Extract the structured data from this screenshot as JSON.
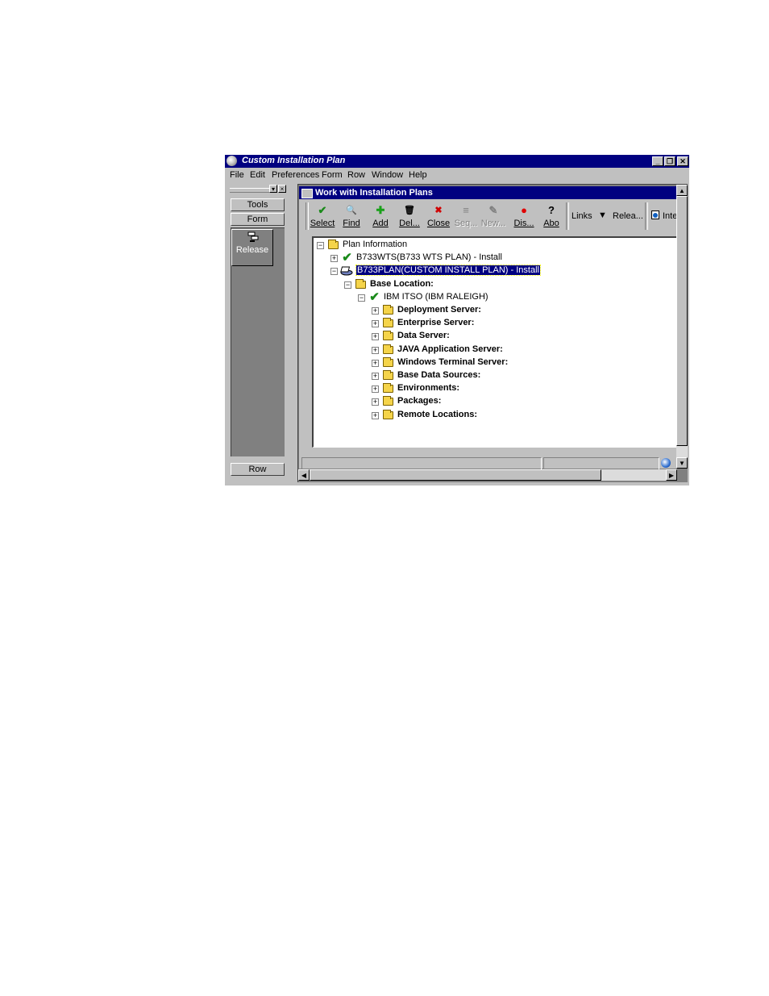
{
  "window": {
    "title": "Custom Installation Plan",
    "minimize": "_",
    "maximize": "❐",
    "close": "✕"
  },
  "menu": [
    "File",
    "Edit",
    "Preferences",
    "Form",
    "Row",
    "Window",
    "Help"
  ],
  "left_panel": {
    "tabs": [
      "Tools",
      "Form"
    ],
    "release_label": "Release",
    "row_label": "Row"
  },
  "child_window": {
    "title": "Work with Installation Plans"
  },
  "toolbar": {
    "buttons": [
      {
        "label": "Select",
        "icon": "✔",
        "disabled": false
      },
      {
        "label": "Find",
        "icon": "🔍",
        "disabled": false
      },
      {
        "label": "Add",
        "icon": "✚",
        "disabled": false
      },
      {
        "label": "Del...",
        "icon": "🗑",
        "disabled": false
      },
      {
        "label": "Close",
        "icon": "✖",
        "disabled": false
      },
      {
        "label": "Seq...",
        "icon": "≡",
        "disabled": true
      },
      {
        "label": "New...",
        "icon": "✎",
        "disabled": true
      },
      {
        "label": "Dis...",
        "icon": "●",
        "disabled": false
      },
      {
        "label": "Abo",
        "icon": "?",
        "disabled": false
      }
    ],
    "links_label": "Links",
    "release_label": "Relea...",
    "inte_label": "Inte"
  },
  "tree": {
    "nodes": [
      {
        "text": "Plan Information",
        "icon": "open-folder",
        "expander": "−",
        "bold": false,
        "selected": false
      },
      {
        "text": "B733WTS(B733 WTS PLAN) - Install",
        "icon": "check",
        "expander": "+",
        "bold": false,
        "selected": false
      },
      {
        "text": "B733PLAN(CUSTOM INSTALL PLAN) - Install",
        "icon": "plan",
        "expander": "−",
        "bold": false,
        "selected": true
      },
      {
        "text": "Base Location:",
        "icon": "open-folder",
        "expander": "−",
        "bold": true,
        "selected": false
      },
      {
        "text": "IBM ITSO (IBM RALEIGH)",
        "icon": "check",
        "expander": "−",
        "bold": false,
        "selected": false
      },
      {
        "text": "Deployment Server:",
        "icon": "folder",
        "expander": "+",
        "bold": true,
        "selected": false
      },
      {
        "text": "Enterprise Server:",
        "icon": "folder",
        "expander": "+",
        "bold": true,
        "selected": false
      },
      {
        "text": "Data Server:",
        "icon": "folder",
        "expander": "+",
        "bold": true,
        "selected": false
      },
      {
        "text": "JAVA Application Server:",
        "icon": "folder",
        "expander": "+",
        "bold": true,
        "selected": false
      },
      {
        "text": "Windows Terminal Server:",
        "icon": "folder",
        "expander": "+",
        "bold": true,
        "selected": false
      },
      {
        "text": "Base Data Sources:",
        "icon": "folder",
        "expander": "+",
        "bold": true,
        "selected": false
      },
      {
        "text": "Environments:",
        "icon": "folder",
        "expander": "+",
        "bold": true,
        "selected": false
      },
      {
        "text": "Packages:",
        "icon": "folder",
        "expander": "+",
        "bold": true,
        "selected": false
      },
      {
        "text": "Remote Locations:",
        "icon": "folder",
        "expander": "+",
        "bold": true,
        "selected": false
      }
    ]
  }
}
